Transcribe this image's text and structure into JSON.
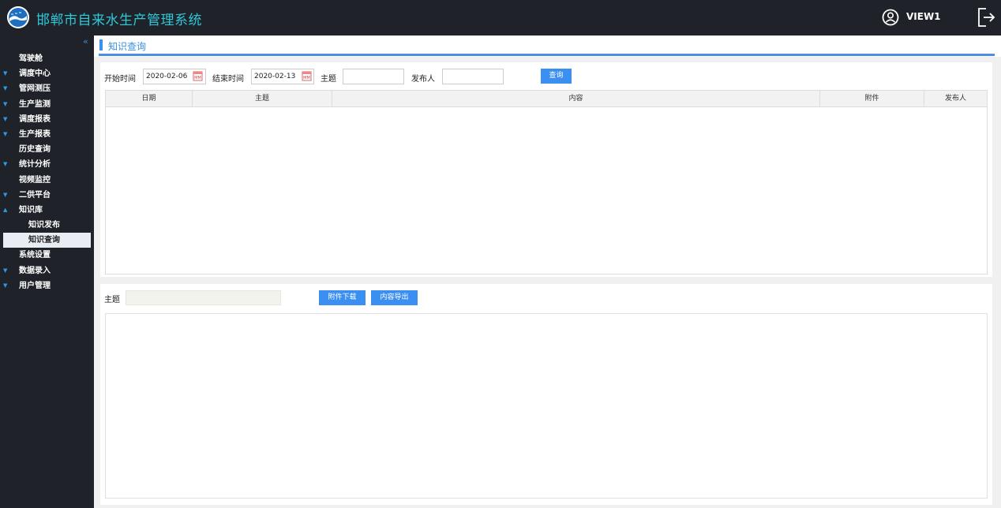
{
  "header": {
    "app_title": "邯郸市自来水生产管理系统",
    "user_name": "VIEW1"
  },
  "sidebar": {
    "collapse_label": "«",
    "items": [
      {
        "label": "驾驶舱",
        "expandable": false,
        "expanded": false
      },
      {
        "label": "调度中心",
        "expandable": true,
        "expanded": false
      },
      {
        "label": "管网测压",
        "expandable": true,
        "expanded": false
      },
      {
        "label": "生产监测",
        "expandable": true,
        "expanded": false
      },
      {
        "label": "调度报表",
        "expandable": true,
        "expanded": false
      },
      {
        "label": "生产报表",
        "expandable": true,
        "expanded": false
      },
      {
        "label": "历史查询",
        "expandable": false,
        "expanded": false
      },
      {
        "label": "统计分析",
        "expandable": true,
        "expanded": false
      },
      {
        "label": "视频监控",
        "expandable": false,
        "expanded": false
      },
      {
        "label": "二供平台",
        "expandable": true,
        "expanded": false
      },
      {
        "label": "知识库",
        "expandable": true,
        "expanded": true
      },
      {
        "label": "知识发布",
        "sub": true
      },
      {
        "label": "知识查询",
        "sub": true,
        "active": true
      },
      {
        "label": "系统设置",
        "expandable": false,
        "expanded": false
      },
      {
        "label": "数据录入",
        "expandable": true,
        "expanded": false
      },
      {
        "label": "用户管理",
        "expandable": true,
        "expanded": false
      }
    ]
  },
  "page": {
    "title": "知识查询"
  },
  "search": {
    "start_label": "开始时间",
    "start_value": "2020-02-06",
    "end_label": "结束时间",
    "end_value": "2020-02-13",
    "topic_label": "主题",
    "topic_value": "",
    "publisher_label": "发布人",
    "publisher_value": "",
    "query_button": "查询"
  },
  "table": {
    "columns": [
      "日期",
      "主题",
      "内容",
      "附件",
      "发布人"
    ],
    "rows": []
  },
  "detail": {
    "topic_label": "主题",
    "topic_value": "",
    "download_button": "附件下载",
    "export_button": "内容导出",
    "content": ""
  },
  "colors": {
    "accent": "#3b8ff0",
    "title": "#2ec7d8",
    "sidebar_bg": "#1f2329"
  }
}
